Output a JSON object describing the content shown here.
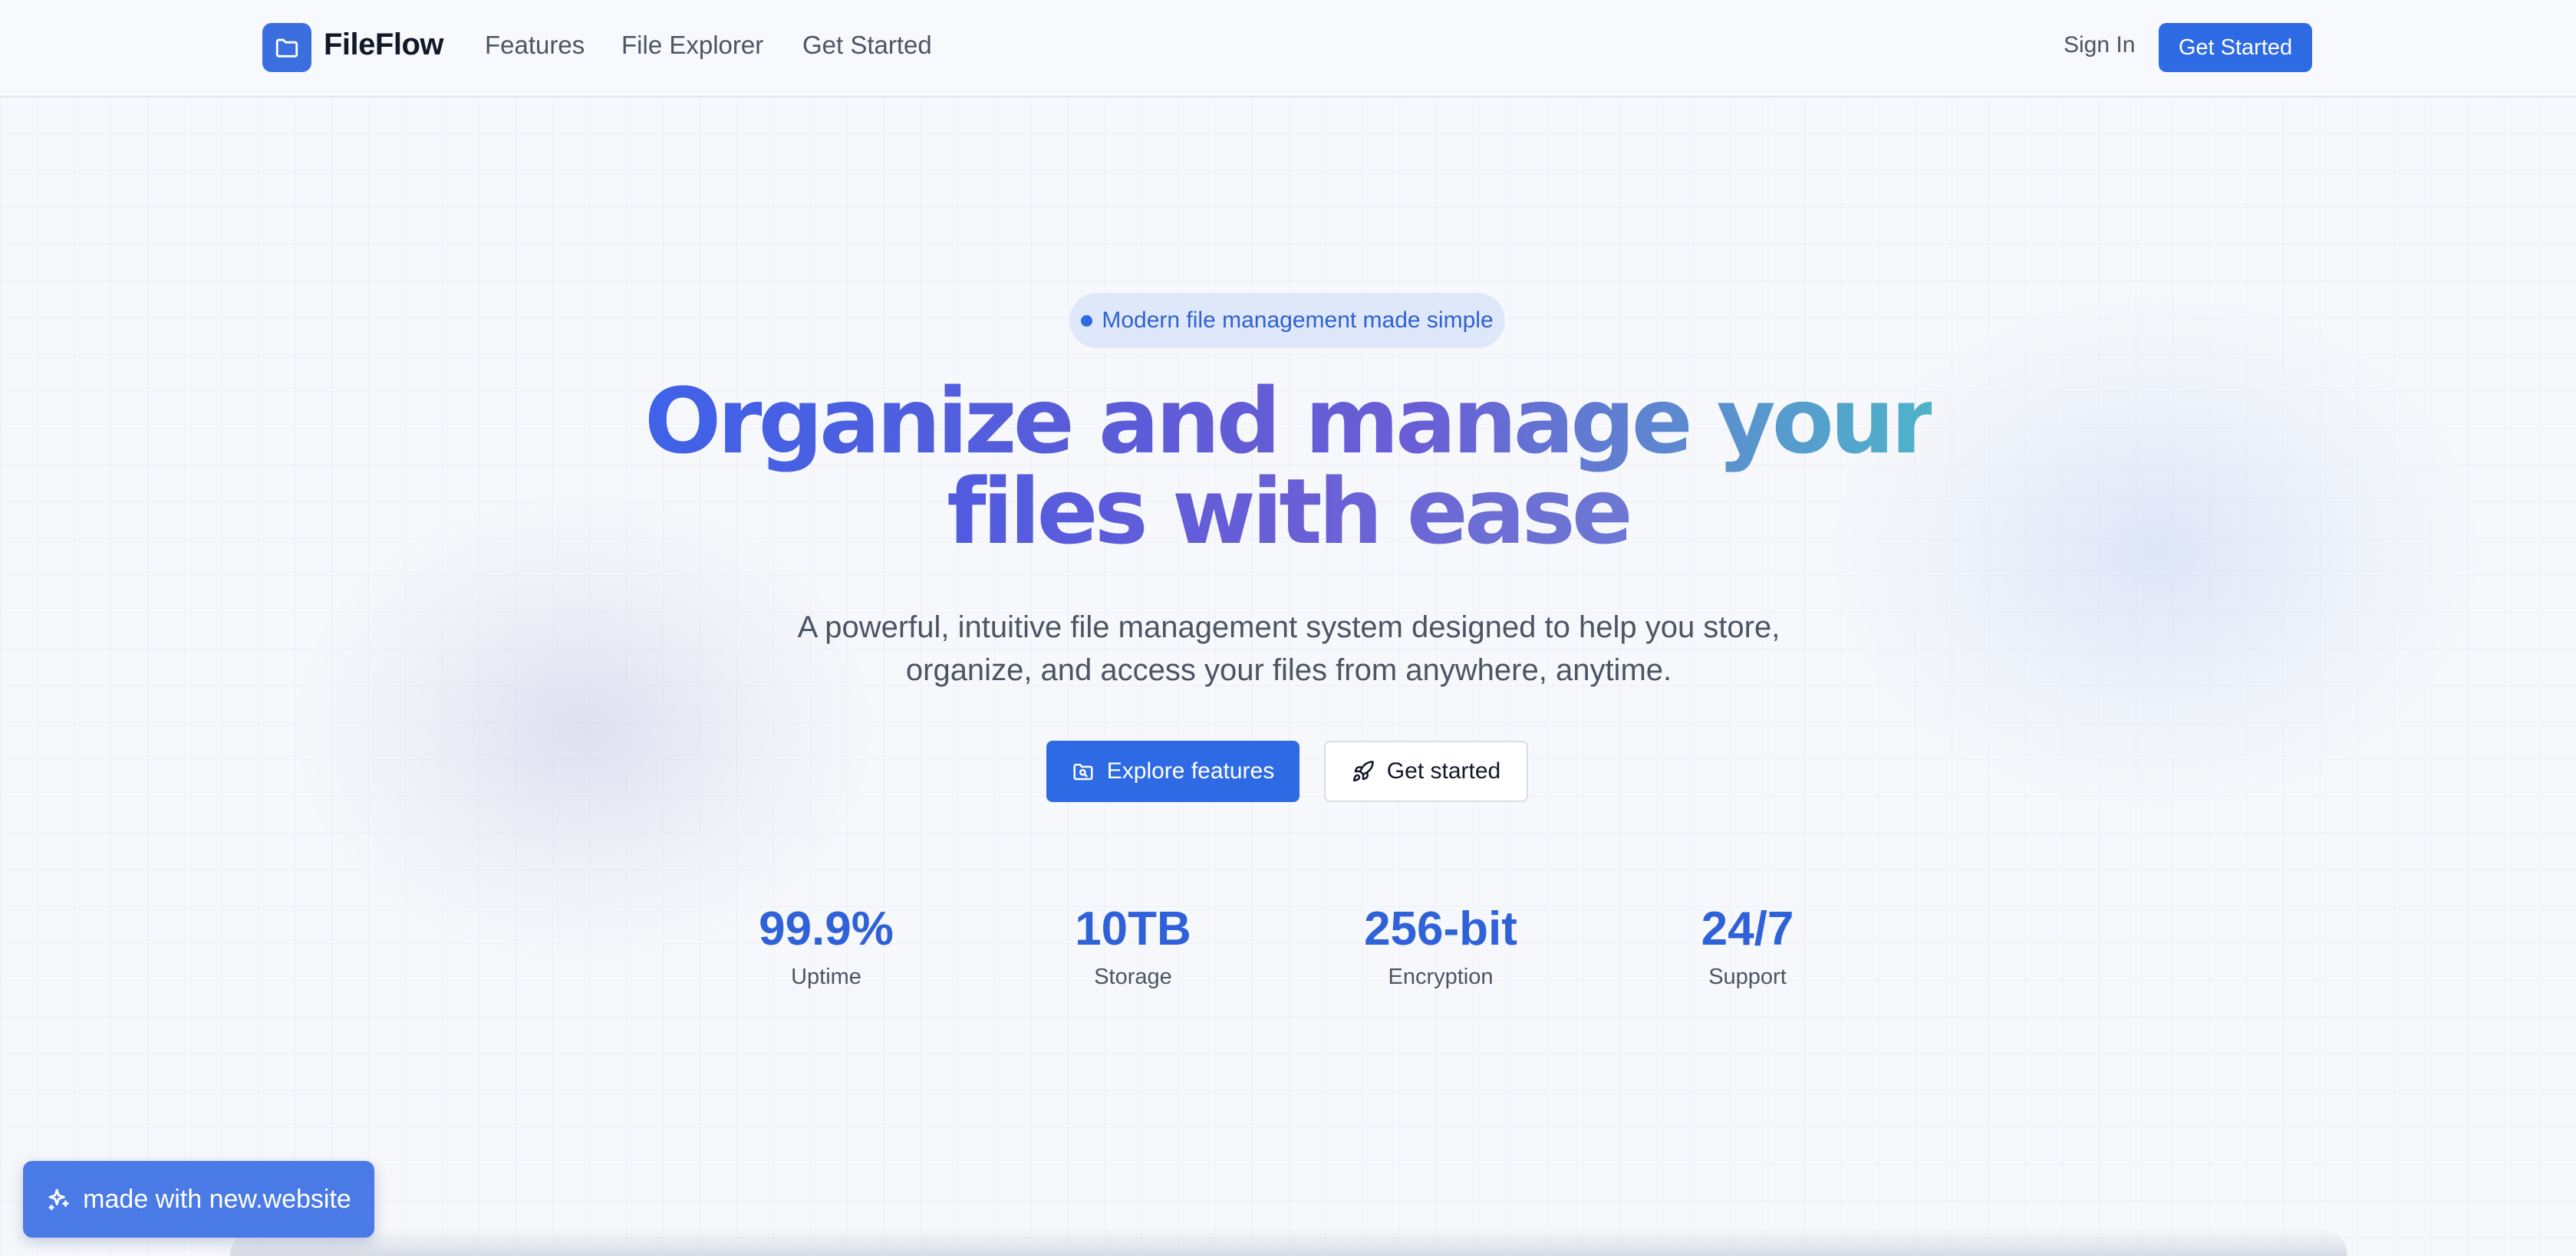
{
  "header": {
    "logo_text": "FileFlow",
    "logo_icon": "folder-icon",
    "nav": [
      "Features",
      "File Explorer",
      "Get Started"
    ],
    "sign_in": "Sign In",
    "cta": "Get Started"
  },
  "hero": {
    "badge": "Modern file management made simple",
    "headline_line1": "Organize and manage your",
    "headline_line2": "files with ease",
    "subtext": "A powerful, intuitive file management system designed to help you store, organize, and access your files from anywhere, anytime.",
    "primary_button": "Explore features",
    "primary_icon": "folder-search-icon",
    "secondary_button": "Get started",
    "secondary_icon": "rocket-icon"
  },
  "stats": [
    {
      "value": "99.9%",
      "label": "Uptime"
    },
    {
      "value": "10TB",
      "label": "Storage"
    },
    {
      "value": "256-bit",
      "label": "Encryption"
    },
    {
      "value": "24/7",
      "label": "Support"
    }
  ],
  "footer_badge": {
    "label": "made with new.website",
    "icon": "sparkles-icon"
  },
  "colors": {
    "accent": "#2f6ae5",
    "background": "#f7f8fb",
    "stat_value": "#2f62d8"
  }
}
